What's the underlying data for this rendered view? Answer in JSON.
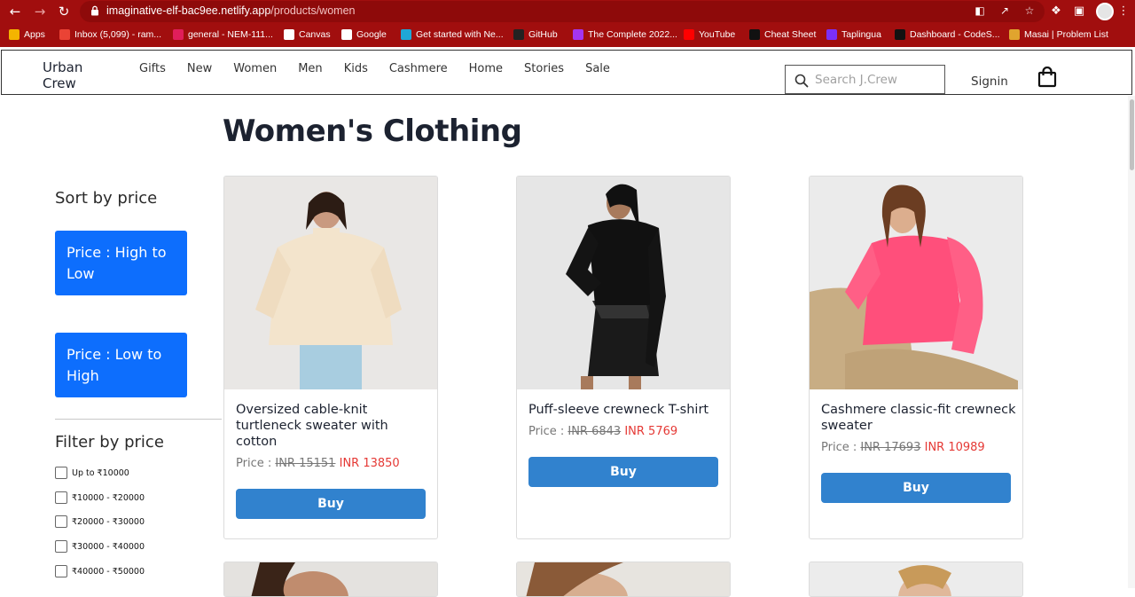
{
  "browser": {
    "url_host": "imaginative-elf-bac9ee.netlify.app",
    "url_path": "/products/women",
    "bookmarks": [
      {
        "label": "Apps",
        "icon": "apps-grid-icon",
        "color": "#f4b400"
      },
      {
        "label": "Inbox (5,099) - ram...",
        "icon": "gmail-icon",
        "color": "#ea4335"
      },
      {
        "label": "general - NEM-111...",
        "icon": "slack-icon",
        "color": "#e01e5a"
      },
      {
        "label": "Canvas",
        "icon": "canvas-icon",
        "color": "#ffffff"
      },
      {
        "label": "Google",
        "icon": "google-icon",
        "color": "#ffffff"
      },
      {
        "label": "Get started with Ne...",
        "icon": "diamond-icon",
        "color": "#1fa7d6"
      },
      {
        "label": "GitHub",
        "icon": "github-icon",
        "color": "#222222"
      },
      {
        "label": "The Complete 2022...",
        "icon": "udemy-icon",
        "color": "#a435f0"
      },
      {
        "label": "YouTube",
        "icon": "youtube-icon",
        "color": "#ff0000"
      },
      {
        "label": "Cheat Sheet",
        "icon": "cheat-sheet-icon",
        "color": "#111111"
      },
      {
        "label": "Taplingua",
        "icon": "star-icon",
        "color": "#7b2ff7"
      },
      {
        "label": "Dashboard - CodeS...",
        "icon": "codesignal-icon",
        "color": "#111111"
      },
      {
        "label": "Masai | Problem List",
        "icon": "masai-icon",
        "color": "#e0a42e"
      }
    ]
  },
  "header": {
    "brand": "Urban Crew",
    "nav": [
      "Gifts",
      "New",
      "Women",
      "Men",
      "Kids",
      "Cashmere",
      "Home",
      "Stories",
      "Sale"
    ],
    "search_placeholder": "Search J.Crew",
    "signin": "Signin"
  },
  "page": {
    "title": "Women's Clothing"
  },
  "sidebar": {
    "sort_title": "Sort by price",
    "sort_high_low": "Price : High to Low",
    "sort_low_high": "Price : Low to High",
    "filter_title": "Filter by price",
    "filters": [
      "Up to ₹10000",
      "₹10000 - ₹20000",
      "₹20000 - ₹30000",
      "₹30000 - ₹40000",
      "₹40000 - ₹50000"
    ]
  },
  "products": [
    {
      "name": "Oversized cable-knit turtleneck sweater with cotton",
      "price_label": "Price :",
      "old_price": "INR 15151",
      "new_price": "INR 13850",
      "buy": "Buy",
      "accent": "#f3e4cc"
    },
    {
      "name": "Puff-sleeve crewneck T-shirt",
      "price_label": "Price :",
      "old_price": "INR 6843",
      "new_price": "INR 5769",
      "buy": "Buy",
      "accent": "#111111"
    },
    {
      "name": "Cashmere classic-fit crewneck sweater",
      "price_label": "Price :",
      "old_price": "INR 17693",
      "new_price": "INR 10989",
      "buy": "Buy",
      "accent": "#ff4f7b"
    }
  ]
}
